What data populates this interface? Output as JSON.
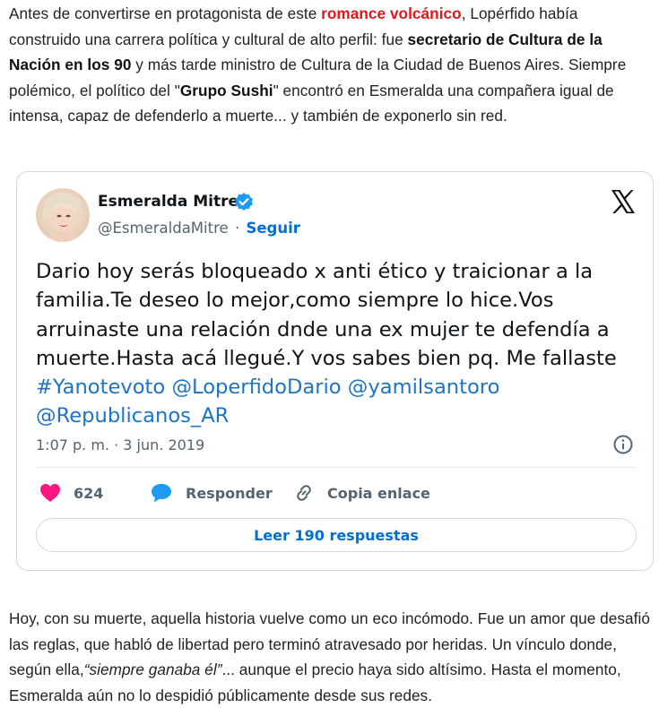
{
  "article": {
    "intro": {
      "p1": "Antes de convertirse en protagonista de este ",
      "link_romance": "romance volcánico",
      "p2": ", Lopérfido había construido una carrera política y cultural de alto perfil: fue ",
      "b1": "secretario de Cultura de la Nación en los 90",
      "p3": " y más tarde ministro de Cultura de la Ciudad de Buenos Aires. Siempre polémico, el político del \"",
      "b2": "Grupo Sushi",
      "p4": "\" encontró en Esmeralda una compañera igual de intensa, capaz de defenderlo a muerte... y también de exponerlo sin red."
    },
    "outro": {
      "p1": "Hoy, con su muerte, aquella historia vuelve como un eco incómodo. Fue un amor que desafió las reglas, que habló de libertad pero terminó atravesado por heridas. Un vínculo donde, según ella,",
      "quote": "“siempre ganaba él”",
      "p2": "... aunque el precio haya sido altísimo. Hasta el momento, Esmeralda aún no lo despidió públicamente desde sus redes."
    }
  },
  "tweet": {
    "author_name": "Esmeralda Mitre",
    "handle": "@EsmeraldaMitre",
    "separator": "·",
    "follow_label": "Seguir",
    "text": "Dario hoy serás bloqueado x anti ético y traicionar a la familia.Te deseo lo mejor,como siempre lo hice.Vos arruinaste una relación dnde una ex mujer te defendía a muerte.Hasta acá llegué.Y vos sabes bien pq. Me fallaste",
    "tags": {
      "hashtag": "#Yanotevoto",
      "mention1": "@LoperfidoDario",
      "mention2": "@yamilsantoro",
      "mention3": "@Republicanos_AR"
    },
    "timestamp": "1:07 p. m. · 3 jun. 2019",
    "likes_count": "624",
    "reply_label": "Responder",
    "copy_label": "Copia enlace",
    "read_replies_label": "Leer 190 respuestas",
    "colors": {
      "link": "#1d74c4",
      "like": "#f91880",
      "reply_icon": "#1d9bf0"
    },
    "icons": [
      "verified-badge-icon",
      "x-logo-icon",
      "info-icon",
      "heart-icon",
      "chat-bubble-icon",
      "link-icon"
    ]
  }
}
